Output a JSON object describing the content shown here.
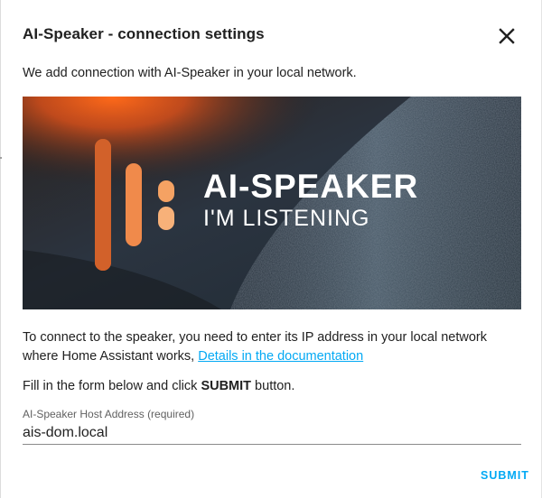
{
  "dialog": {
    "title": "AI-Speaker - connection settings",
    "close_icon": "close-icon",
    "intro": "We add connection with AI-Speaker in your local network."
  },
  "hero": {
    "brand": "AI-SPEAKER",
    "tagline": "I'M LISTENING",
    "accent_color": "#f08a4b",
    "accent_dark": "#c85a21"
  },
  "instructions": {
    "text": "To connect to the speaker, you need to enter its IP address in your local network where Home Assistant works, ",
    "link_text": "Details in the documentation",
    "form_prefix": "Fill in the form below and click ",
    "form_bold": "SUBMIT",
    "form_suffix": " button."
  },
  "form": {
    "host_label": "AI-Speaker Host Address (required)",
    "host_value": "ais-dom.local"
  },
  "actions": {
    "submit_label": "SUBMIT",
    "primary_color": "#03a9f4"
  }
}
